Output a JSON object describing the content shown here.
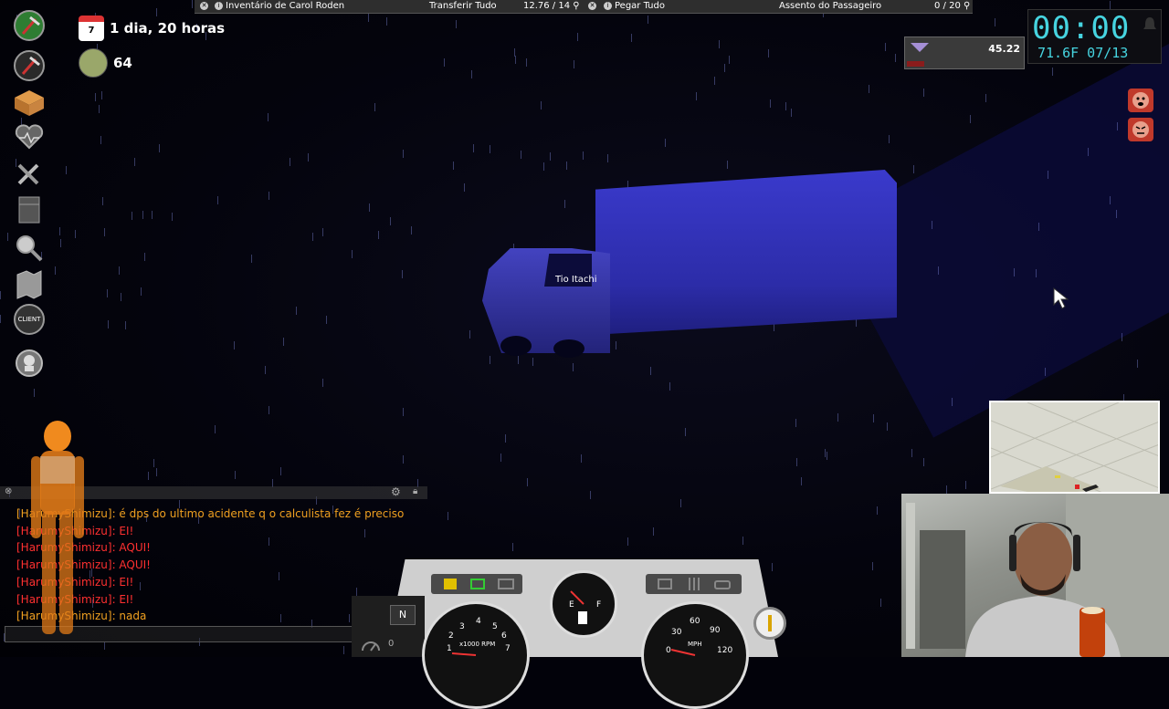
{
  "top_bar": {
    "left_inventory_title": "Inventário de Carol Roden",
    "transfer_all": "Transferir Tudo",
    "left_weight": "12.76 / 14",
    "take_all": "Pegar Tudo",
    "right_inventory_title": "Assento do Passageiro",
    "right_weight": "0 / 20"
  },
  "stats": {
    "days_survived": "1 dia, 20 horas",
    "zombie_kills": "64",
    "calendar_day": "7"
  },
  "weight_panel": {
    "value": "45.22",
    "fill_fraction": 0.15
  },
  "clock": {
    "time": "00:00",
    "temp_date": "71.6F 07/13"
  },
  "world": {
    "npc_name": "Tio Itachi"
  },
  "left_menu": {
    "items": [
      "primary-weapon-icon",
      "secondary-weapon-icon",
      "inventory-box-icon",
      "health-heart-icon",
      "crafting-hammer-icon",
      "furniture-icon",
      "search-magnifier-icon",
      "map-icon",
      "client-icon",
      "zombie-settings-icon"
    ],
    "client_label": "CLIENT"
  },
  "chat": {
    "messages": [
      {
        "user": "[HarumyShimizu]",
        "text": ": é dps do ultimo acidente q o calculista fez é preciso",
        "color": "#f0a020"
      },
      {
        "user": "[HarumyShimizu]",
        "text": ": EI!",
        "color": "#ff3030"
      },
      {
        "user": "[HarumyShimizu]",
        "text": ": AQUI!",
        "color": "#ff3030"
      },
      {
        "user": "[HarumyShimizu]",
        "text": ": AQUI!",
        "color": "#ff3030"
      },
      {
        "user": "[HarumyShimizu]",
        "text": ": EI!",
        "color": "#ff3030"
      },
      {
        "user": "[HarumyShimizu]",
        "text": ": EI!",
        "color": "#ff3030"
      },
      {
        "user": "[HarumyShimizu]",
        "text": ": nada",
        "color": "#f0a020"
      }
    ]
  },
  "dashboard": {
    "gear": "N",
    "speed_small": "0",
    "rpm_label": "x1000 RPM",
    "rpm_ticks": [
      "1",
      "2",
      "3",
      "4",
      "5",
      "6",
      "7"
    ],
    "mph_label": "MPH",
    "mph_ticks": [
      "0",
      "30",
      "60",
      "90",
      "120"
    ],
    "fuel_empty": "E",
    "fuel_full": "F"
  },
  "colors": {
    "clock": "#46d4e0",
    "truck": "#3a3acc",
    "chat_orange": "#f0a020",
    "chat_red": "#ff3030"
  }
}
